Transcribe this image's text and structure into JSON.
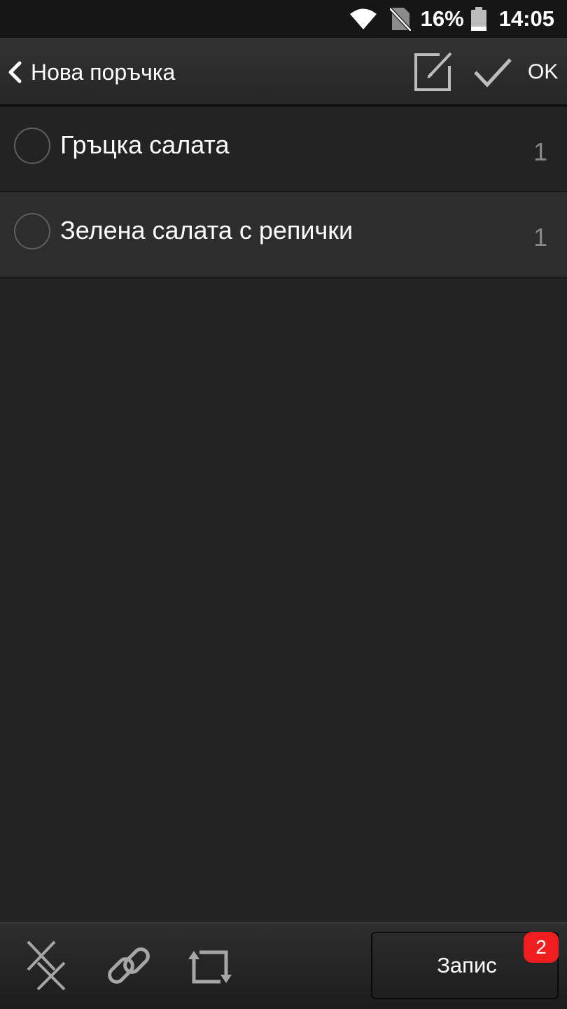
{
  "status_bar": {
    "battery_percent": "16%",
    "time": "14:05",
    "icons": [
      "wifi-icon",
      "no-sim-icon",
      "battery-icon"
    ]
  },
  "header": {
    "title": "Нова поръчка",
    "ok_label": "OK",
    "icons": [
      "chevron-left-icon",
      "edit-note-icon",
      "checkmark-icon"
    ]
  },
  "order_items": [
    {
      "name": "Гръцка салата",
      "quantity": "1",
      "selected": false
    },
    {
      "name": "Зелена салата с репички",
      "quantity": "1",
      "selected": false
    }
  ],
  "bottom_bar": {
    "record_label": "Запис",
    "badge_count": "2",
    "icons": [
      "remove-items-icon",
      "link-icon",
      "rotate-icon"
    ]
  },
  "colors": {
    "background": "#232323",
    "alt_row": "#2d2d2d",
    "badge": "#f01e1e",
    "muted_text": "#8a8a8a"
  }
}
